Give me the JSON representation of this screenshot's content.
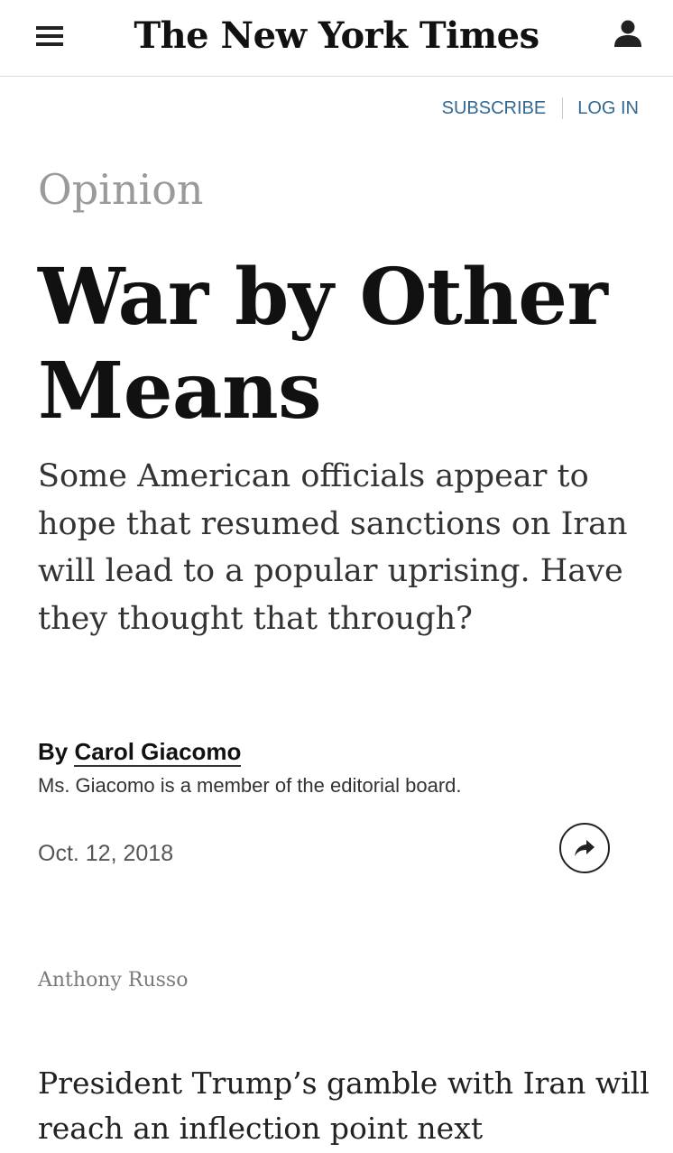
{
  "header": {
    "logo": "The New York Times",
    "menu_icon": "hamburger-menu-icon",
    "account_icon": "user-account-icon"
  },
  "auth": {
    "subscribe": "SUBSCRIBE",
    "login": "LOG IN",
    "link_color": "#326891"
  },
  "article": {
    "section": "Opinion",
    "headline": "War by Other Means",
    "summary": "Some American officials appear to hope that resumed sanctions on Iran will lead to a popular uprising. Have they thought that through?",
    "byline_prefix": "By",
    "author": "Carol Giacomo",
    "author_bio": "Ms. Giacomo is a member of the editorial board.",
    "date": "Oct. 12, 2018",
    "share_icon": "share-arrow-icon",
    "image_credit": "Anthony Russo",
    "body_first_lines": "President Trump’s gamble with Iran will reach an inflection point next"
  }
}
